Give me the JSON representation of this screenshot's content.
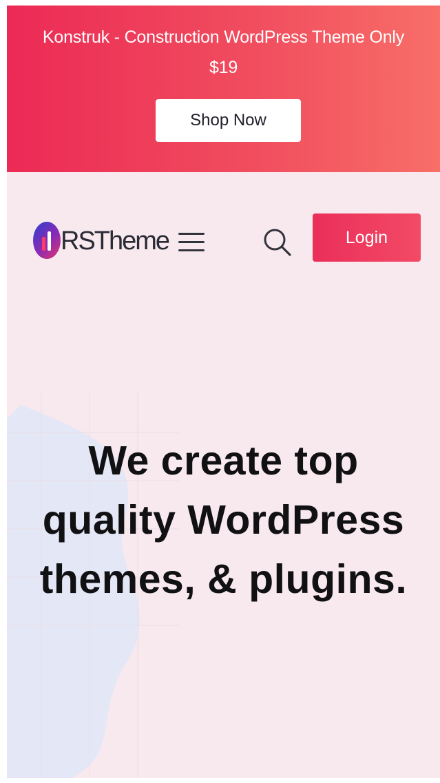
{
  "promo": {
    "text": "Konstruk - Construction WordPress Theme Only $19",
    "button_label": "Shop Now"
  },
  "header": {
    "logo_text": "RSTheme",
    "menu_icon": "hamburger-icon",
    "search_icon": "search-icon",
    "login_label": "Login"
  },
  "hero": {
    "title": "We create top quality WordPress themes, & plugins."
  },
  "colors": {
    "promo_gradient_start": "#ec2a55",
    "promo_gradient_end": "#f86e68",
    "accent": "#ea2f59",
    "page_background": "#f8e9ef",
    "text_dark": "#111114"
  }
}
